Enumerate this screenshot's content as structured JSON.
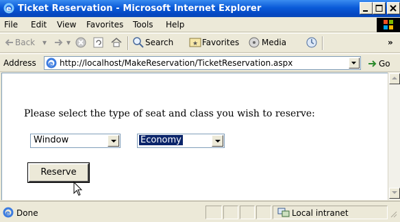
{
  "window": {
    "title": "Ticket Reservation - Microsoft Internet Explorer"
  },
  "menu": {
    "items": [
      "File",
      "Edit",
      "View",
      "Favorites",
      "Tools",
      "Help"
    ]
  },
  "toolbar": {
    "back_label": "Back",
    "search_label": "Search",
    "favorites_label": "Favorites",
    "media_label": "Media",
    "overflow_label": "»"
  },
  "address": {
    "label": "Address",
    "url": "http://localhost/MakeReservation/TicketReservation.aspx",
    "go_label": "Go"
  },
  "page": {
    "prompt": "Please select the type of seat and class you wish to reserve:",
    "seat_select": {
      "selected": "Window"
    },
    "class_select": {
      "selected": "Economy"
    },
    "reserve_button": "Reserve"
  },
  "status": {
    "text": "Done",
    "zone": "Local intranet"
  }
}
